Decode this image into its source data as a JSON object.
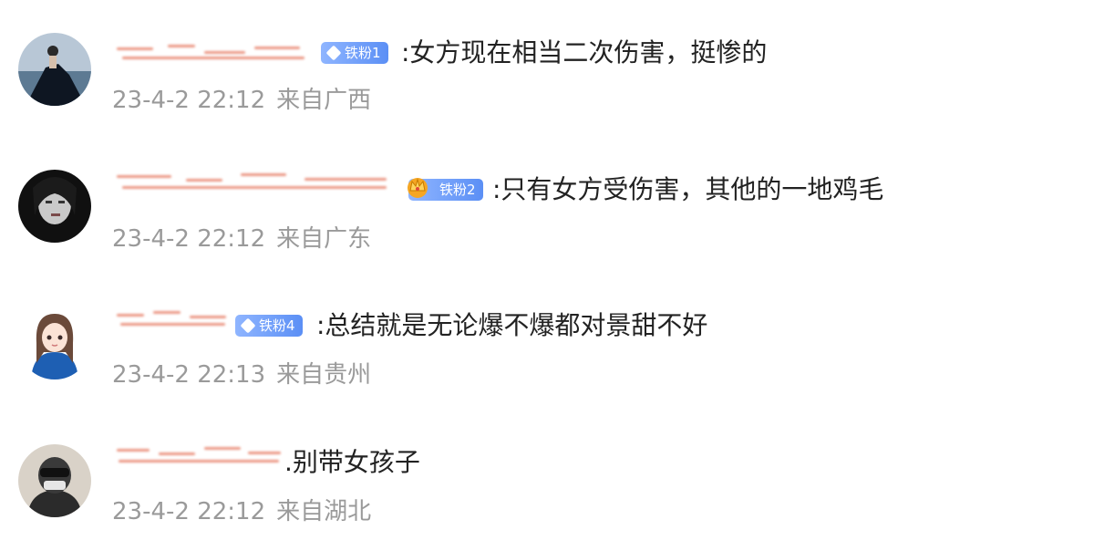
{
  "comments": [
    {
      "avatar": "woman-in-dress-by-sea-photo",
      "badge": "铁粉1",
      "badge_icon": "diamond-icon",
      "text": ":女方现在相当二次伤害，挺惨的",
      "time": "23-4-2 22:12",
      "location": "来自广西"
    },
    {
      "avatar": "dark-portrait-photo",
      "badge": "铁粉2",
      "badge_icon": "crown-icon",
      "text": ":只有女方受伤害，其他的一地鸡毛",
      "time": "23-4-2 22:12",
      "location": "来自广东"
    },
    {
      "avatar": "anime-girl-illustration",
      "badge": "铁粉4",
      "badge_icon": "diamond-icon",
      "text": ":总结就是无论爆不爆都对景甜不好",
      "time": "23-4-2 22:13",
      "location": "来自贵州"
    },
    {
      "avatar": "masked-person-photo",
      "badge": "",
      "badge_icon": "",
      "text": ".别带女孩子",
      "time": "23-4-2 22:12",
      "location": "来自湖北"
    }
  ],
  "colors": {
    "badge_blue": "#5b8ff5",
    "blurred_name": "#e8856f",
    "meta_gray": "#9a9a9a",
    "text": "#222222"
  }
}
